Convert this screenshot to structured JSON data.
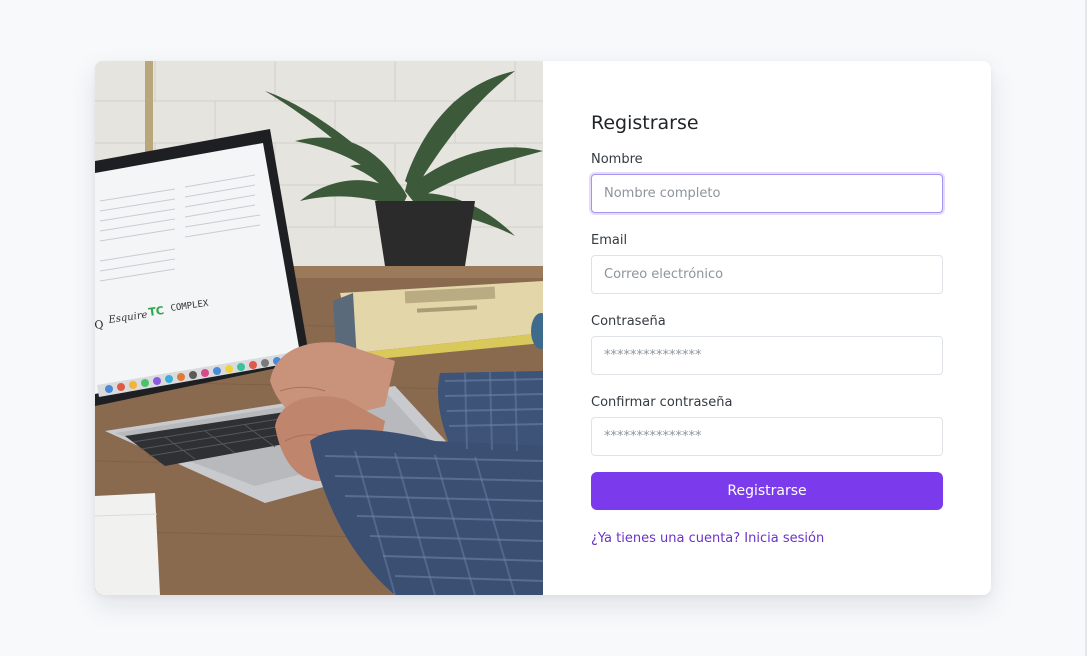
{
  "form": {
    "title": "Registrarse",
    "fields": [
      {
        "label": "Nombre",
        "placeholder": "Nombre completo",
        "type": "text",
        "focused": true
      },
      {
        "label": "Email",
        "placeholder": "Correo electrónico",
        "type": "email",
        "focused": false
      },
      {
        "label": "Contraseña",
        "placeholder": "***************",
        "type": "password",
        "focused": false
      },
      {
        "label": "Confirmar contraseña",
        "placeholder": "***************",
        "type": "password",
        "focused": false
      }
    ],
    "submit_label": "Registrarse",
    "login_link": "¿Ya tienes una cuenta? Inicia sesión"
  },
  "theme": {
    "accent": "#7c3aed",
    "link": "#6b34c9",
    "background": "#f7f9fb"
  }
}
